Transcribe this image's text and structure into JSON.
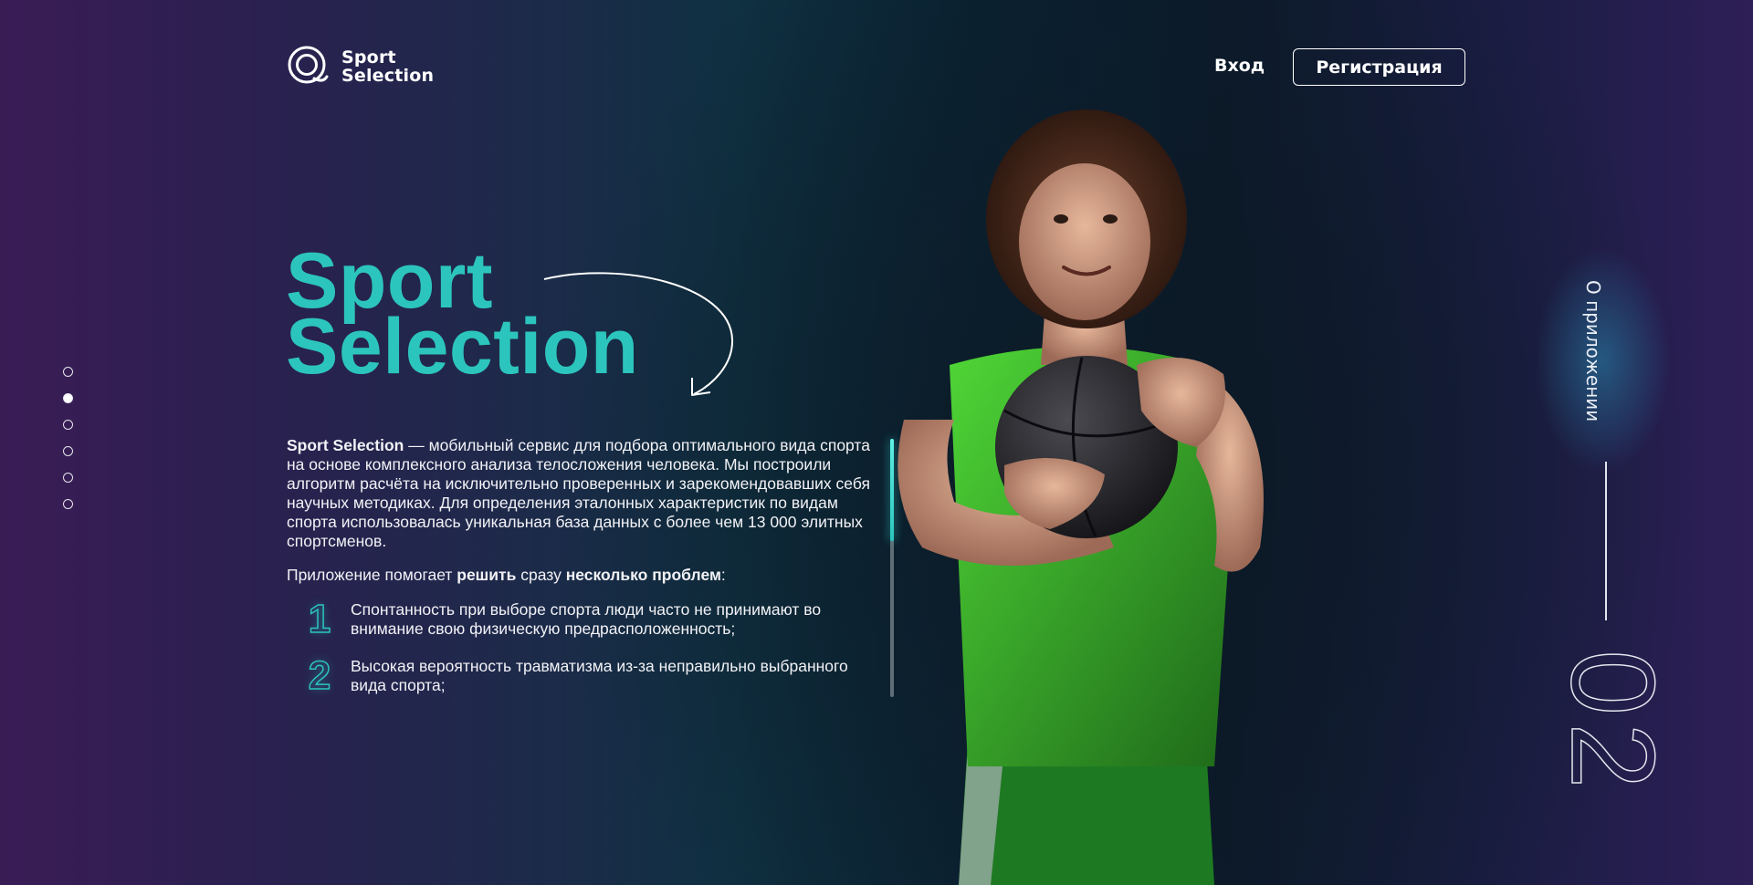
{
  "header": {
    "logo_line1": "Sport",
    "logo_line2": "Selection",
    "login_label": "Вход",
    "register_label": "Регистрация"
  },
  "pager": {
    "count": 6,
    "active_index": 1
  },
  "hero": {
    "title_line1": "Sport",
    "title_line2": "Selection"
  },
  "description": {
    "brand": "Sport Selection",
    "text": " — мобильный сервис для подбора оптимального вида спорта на основе комплексного анализа телосложения человека. Мы построили алгоритм расчёта на исключительно проверенных и зарекомендовавших себя научных методиках. Для определения эталонных характеристик по видам спорта использовалась уникальная база данных с более чем 13 000 элитных спортсменов."
  },
  "lead": {
    "part1": "Приложение помогает ",
    "bold1": "решить",
    "part2": " сразу ",
    "bold2": "несколько проблем",
    "part3": ":"
  },
  "problems": [
    {
      "num": "1",
      "text": "Спонтанность при выборе спорта люди часто не принимают во внимание свою физическую предрасположенность;"
    },
    {
      "num": "2",
      "text": "Высокая вероятность травматизма из-за неправильно выбранного вида спорта;"
    }
  ],
  "scroll": {
    "position": 0.0
  },
  "section": {
    "label": "О приложении",
    "number": "02"
  },
  "colors": {
    "accent": "#2cc5bd",
    "bg_left": "#3a1c55",
    "bg_mid": "#0a2232",
    "bg_right": "#2e1f57",
    "jersey": "#3cbf2a"
  }
}
